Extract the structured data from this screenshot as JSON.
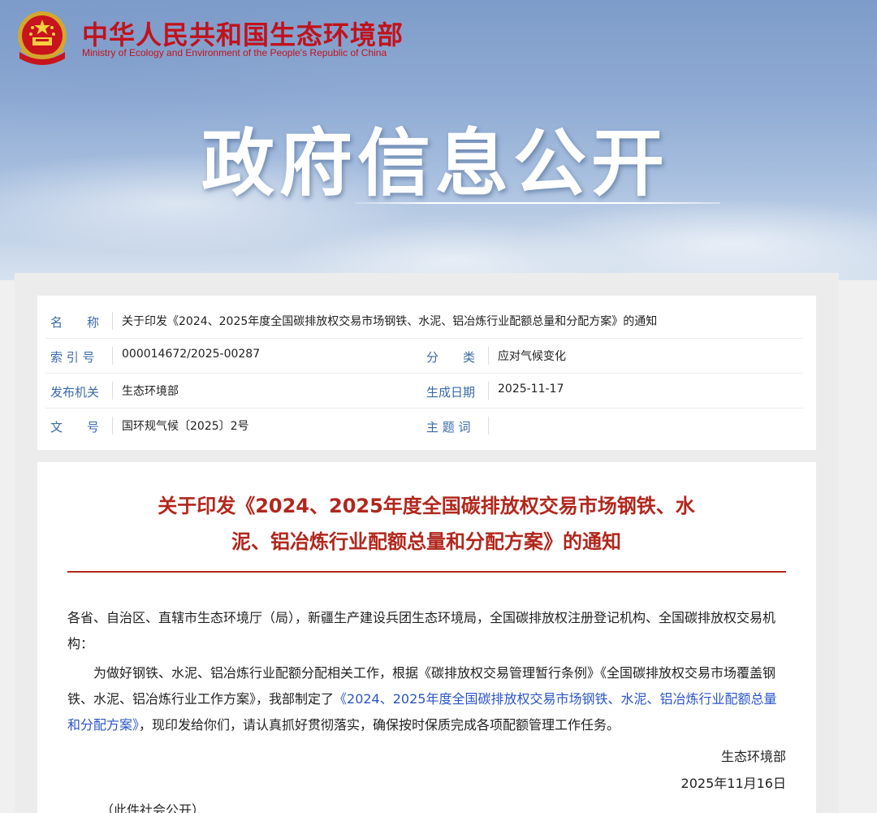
{
  "header": {
    "ministry_cn": "中华人民共和国生态环境部",
    "ministry_en": "Ministry of Ecology and Environment of the People's Republic of China",
    "emblem_icon": "national-emblem-icon",
    "banner_title": "政府信息公开",
    "colors": {
      "brand_red": "#c1121c",
      "sky_blue": "#8fabd4"
    }
  },
  "meta": {
    "name_label": "名　　称",
    "name_value": "关于印发《2024、2025年度全国碳排放权交易市场钢铁、水泥、铝冶炼行业配额总量和分配方案》的通知",
    "index_label": "索 引 号",
    "index_value": "000014672/2025-00287",
    "category_label": "分　　类",
    "category_value": "应对气候变化",
    "issuer_label": "发布机关",
    "issuer_value": "生态环境部",
    "date_label": "生成日期",
    "date_value": "2025-11-17",
    "docno_label": "文　　号",
    "docno_value": "国环规气候〔2025〕2号",
    "topic_label": "主 题 词",
    "topic_value": ""
  },
  "doc": {
    "title_line1": "关于印发《2024、2025年度全国碳排放权交易市场钢铁、水",
    "title_line2": "泥、铝冶炼行业配额总量和分配方案》的通知",
    "salutation": "各省、自治区、直辖市生态环境厅（局），新疆生产建设兵团生态环境局，全国碳排放权注册登记机构、全国碳排放权交易机构：",
    "body_before_link": "为做好钢铁、水泥、铝冶炼行业配额分配相关工作，根据《碳排放权交易管理暂行条例》《全国碳排放权交易市场覆盖钢铁、水泥、铝冶炼行业工作方案》，我部制定了",
    "body_link": "《2024、2025年度全国碳排放权交易市场钢铁、水泥、铝冶炼行业配额总量和分配方案》",
    "body_after_link": "，现印发给你们，请认真抓好贯彻落实，确保按时保质完成各项配额管理工作任务。",
    "signature": "生态环境部",
    "sign_date": "2025年11月16日",
    "public_note": "（此件社会公开）",
    "colors": {
      "title_red": "#b1271d",
      "link_blue": "#2a55c9"
    }
  }
}
